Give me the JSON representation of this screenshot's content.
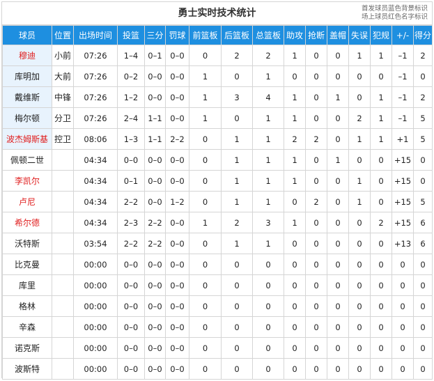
{
  "header": {
    "title": "勇士实时技术统计",
    "legend_line1": "首发球员蓝色背景标识",
    "legend_line2": "场上球员红色名字标识"
  },
  "columns": [
    "球员",
    "位置",
    "出场时间",
    "投篮",
    "三分",
    "罚球",
    "前篮板",
    "后篮板",
    "总篮板",
    "助攻",
    "抢断",
    "盖帽",
    "失误",
    "犯规",
    "+/-",
    "得分"
  ],
  "colors": {
    "header_bg": "#1e8fe0",
    "starter_bg": "#e8f3fd",
    "oncourt_text": "#e02020"
  },
  "players": [
    {
      "name": "穆迪",
      "pos": "小前",
      "min": "07:26",
      "fg": "1–4",
      "three": "0–1",
      "ft": "0–0",
      "oreb": "0",
      "dreb": "2",
      "reb": "2",
      "ast": "1",
      "stl": "0",
      "blk": "0",
      "tov": "1",
      "pf": "1",
      "pm": "–1",
      "pts": "2",
      "starter": true,
      "oncourt": true
    },
    {
      "name": "库明加",
      "pos": "大前",
      "min": "07:26",
      "fg": "0–2",
      "three": "0–0",
      "ft": "0–0",
      "oreb": "1",
      "dreb": "0",
      "reb": "1",
      "ast": "0",
      "stl": "0",
      "blk": "0",
      "tov": "0",
      "pf": "0",
      "pm": "–1",
      "pts": "0",
      "starter": true,
      "oncourt": false
    },
    {
      "name": "戴维斯",
      "pos": "中锋",
      "min": "07:26",
      "fg": "1–2",
      "three": "0–0",
      "ft": "0–0",
      "oreb": "1",
      "dreb": "3",
      "reb": "4",
      "ast": "1",
      "stl": "0",
      "blk": "1",
      "tov": "0",
      "pf": "1",
      "pm": "–1",
      "pts": "2",
      "starter": true,
      "oncourt": false
    },
    {
      "name": "梅尔顿",
      "pos": "分卫",
      "min": "07:26",
      "fg": "2–4",
      "three": "1–1",
      "ft": "0–0",
      "oreb": "1",
      "dreb": "0",
      "reb": "1",
      "ast": "1",
      "stl": "0",
      "blk": "0",
      "tov": "2",
      "pf": "1",
      "pm": "–1",
      "pts": "5",
      "starter": true,
      "oncourt": false
    },
    {
      "name": "波杰姆斯基",
      "pos": "控卫",
      "min": "08:06",
      "fg": "1–3",
      "three": "1–1",
      "ft": "2–2",
      "oreb": "0",
      "dreb": "1",
      "reb": "1",
      "ast": "2",
      "stl": "2",
      "blk": "0",
      "tov": "1",
      "pf": "1",
      "pm": "+1",
      "pts": "5",
      "starter": true,
      "oncourt": true
    },
    {
      "name": "佩顿二世",
      "pos": "",
      "min": "04:34",
      "fg": "0–0",
      "three": "0–0",
      "ft": "0–0",
      "oreb": "0",
      "dreb": "1",
      "reb": "1",
      "ast": "1",
      "stl": "0",
      "blk": "1",
      "tov": "0",
      "pf": "0",
      "pm": "+15",
      "pts": "0",
      "starter": false,
      "oncourt": false
    },
    {
      "name": "李凯尔",
      "pos": "",
      "min": "04:34",
      "fg": "0–1",
      "three": "0–0",
      "ft": "0–0",
      "oreb": "0",
      "dreb": "1",
      "reb": "1",
      "ast": "1",
      "stl": "0",
      "blk": "0",
      "tov": "1",
      "pf": "0",
      "pm": "+15",
      "pts": "0",
      "starter": false,
      "oncourt": true
    },
    {
      "name": "卢尼",
      "pos": "",
      "min": "04:34",
      "fg": "2–2",
      "three": "0–0",
      "ft": "1–2",
      "oreb": "0",
      "dreb": "1",
      "reb": "1",
      "ast": "0",
      "stl": "2",
      "blk": "0",
      "tov": "1",
      "pf": "0",
      "pm": "+15",
      "pts": "5",
      "starter": false,
      "oncourt": true
    },
    {
      "name": "希尔德",
      "pos": "",
      "min": "04:34",
      "fg": "2–3",
      "three": "2–2",
      "ft": "0–0",
      "oreb": "1",
      "dreb": "2",
      "reb": "3",
      "ast": "1",
      "stl": "0",
      "blk": "0",
      "tov": "0",
      "pf": "2",
      "pm": "+15",
      "pts": "6",
      "starter": false,
      "oncourt": true
    },
    {
      "name": "沃特斯",
      "pos": "",
      "min": "03:54",
      "fg": "2–2",
      "three": "2–2",
      "ft": "0–0",
      "oreb": "0",
      "dreb": "1",
      "reb": "1",
      "ast": "0",
      "stl": "0",
      "blk": "0",
      "tov": "0",
      "pf": "0",
      "pm": "+13",
      "pts": "6",
      "starter": false,
      "oncourt": false
    },
    {
      "name": "比克曼",
      "pos": "",
      "min": "00:00",
      "fg": "0–0",
      "three": "0–0",
      "ft": "0–0",
      "oreb": "0",
      "dreb": "0",
      "reb": "0",
      "ast": "0",
      "stl": "0",
      "blk": "0",
      "tov": "0",
      "pf": "0",
      "pm": "0",
      "pts": "0",
      "starter": false,
      "oncourt": false
    },
    {
      "name": "库里",
      "pos": "",
      "min": "00:00",
      "fg": "0–0",
      "three": "0–0",
      "ft": "0–0",
      "oreb": "0",
      "dreb": "0",
      "reb": "0",
      "ast": "0",
      "stl": "0",
      "blk": "0",
      "tov": "0",
      "pf": "0",
      "pm": "0",
      "pts": "0",
      "starter": false,
      "oncourt": false
    },
    {
      "name": "格林",
      "pos": "",
      "min": "00:00",
      "fg": "0–0",
      "three": "0–0",
      "ft": "0–0",
      "oreb": "0",
      "dreb": "0",
      "reb": "0",
      "ast": "0",
      "stl": "0",
      "blk": "0",
      "tov": "0",
      "pf": "0",
      "pm": "0",
      "pts": "0",
      "starter": false,
      "oncourt": false
    },
    {
      "name": "辛森",
      "pos": "",
      "min": "00:00",
      "fg": "0–0",
      "three": "0–0",
      "ft": "0–0",
      "oreb": "0",
      "dreb": "0",
      "reb": "0",
      "ast": "0",
      "stl": "0",
      "blk": "0",
      "tov": "0",
      "pf": "0",
      "pm": "0",
      "pts": "0",
      "starter": false,
      "oncourt": false
    },
    {
      "name": "诺克斯",
      "pos": "",
      "min": "00:00",
      "fg": "0–0",
      "three": "0–0",
      "ft": "0–0",
      "oreb": "0",
      "dreb": "0",
      "reb": "0",
      "ast": "0",
      "stl": "0",
      "blk": "0",
      "tov": "0",
      "pf": "0",
      "pm": "0",
      "pts": "0",
      "starter": false,
      "oncourt": false
    },
    {
      "name": "波斯特",
      "pos": "",
      "min": "00:00",
      "fg": "0–0",
      "three": "0–0",
      "ft": "0–0",
      "oreb": "0",
      "dreb": "0",
      "reb": "0",
      "ast": "0",
      "stl": "0",
      "blk": "0",
      "tov": "0",
      "pf": "0",
      "pm": "0",
      "pts": "0",
      "starter": false,
      "oncourt": false
    }
  ]
}
